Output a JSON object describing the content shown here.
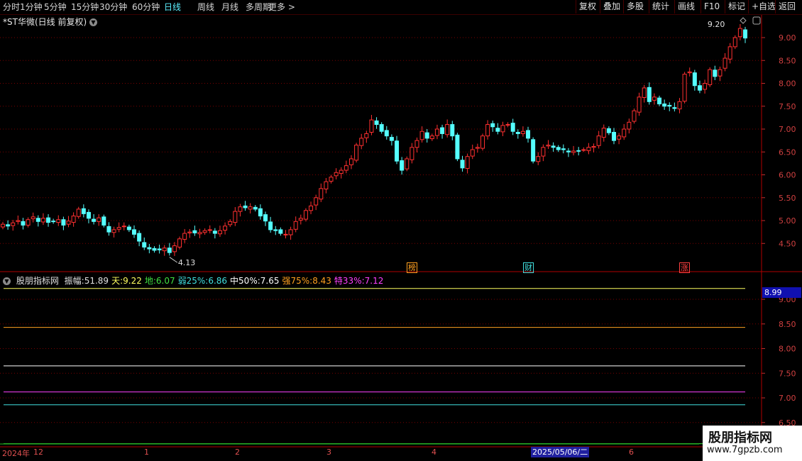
{
  "toolbar": {
    "periods": [
      "分时",
      "1分钟",
      "5分钟",
      "15分钟",
      "30分钟",
      "60分钟",
      "日线",
      "周线",
      "月线",
      "多周期",
      "更多 >"
    ],
    "active_period": "日线",
    "right_buttons": [
      "复权",
      "叠加",
      "多股",
      "统计",
      "画线",
      "F10",
      "+自选",
      "返回"
    ],
    "tag_label": "标记"
  },
  "stock": {
    "title": "*ST华微(日线 前复权)"
  },
  "indicator": {
    "name": "股朋指标网",
    "items": [
      {
        "label": "振幅:",
        "value": "51.89",
        "color": "#e0e0e0"
      },
      {
        "label": "天:",
        "value": "9.22",
        "color": "#ffff60"
      },
      {
        "label": "地:",
        "value": "6.07",
        "color": "#40e040"
      },
      {
        "label": "弱25%:",
        "value": "6.86",
        "color": "#40e0e0"
      },
      {
        "label": "中50%:",
        "value": "7.65",
        "color": "#ffffff"
      },
      {
        "label": "强75%:",
        "value": "8.43",
        "color": "#ffa020"
      },
      {
        "label": "特33%:",
        "value": "7.12",
        "color": "#ff40ff"
      }
    ],
    "last_price_box": "8.99"
  },
  "axes": {
    "price_ticks": [
      "9.00",
      "8.50",
      "8.00",
      "7.50",
      "7.00",
      "6.50",
      "6.00",
      "5.50",
      "5.00",
      "4.50"
    ],
    "indicator_ticks": [
      "9.00",
      "8.50",
      "8.00",
      "7.50",
      "7.00",
      "6.50"
    ],
    "date_labels": [
      "2024年",
      "12",
      "1",
      "2",
      "3",
      "4",
      "6"
    ],
    "highlight_date": "2025/05/06/二"
  },
  "annotations": {
    "high_label": "9.20",
    "low_label": "4.13",
    "event_tags": [
      {
        "text": "榜",
        "color": "#ffa020"
      },
      {
        "text": "财",
        "color": "#40e0e0"
      },
      {
        "text": "涨",
        "color": "#ff4040"
      }
    ]
  },
  "watermark": {
    "big": "股朋指标网",
    "small": "www.7gpzb.com"
  },
  "colors": {
    "up": "#ff3030",
    "down": "#55ffff",
    "grid": "#7a0000",
    "bg": "#000000"
  },
  "chart_data": {
    "type": "candlestick",
    "ylim": [
      4.13,
      9.2
    ],
    "indicator_lines": [
      {
        "name": "天",
        "value": 9.22,
        "color": "#ffff60"
      },
      {
        "name": "强75%",
        "value": 8.43,
        "color": "#ffa020"
      },
      {
        "name": "中50%",
        "value": 7.65,
        "color": "#ffffff"
      },
      {
        "name": "特33%",
        "value": 7.12,
        "color": "#ff40ff"
      },
      {
        "name": "弱25%",
        "value": 6.86,
        "color": "#40e0e0"
      },
      {
        "name": "地",
        "value": 6.07,
        "color": "#40e040"
      }
    ],
    "closes": [
      4.92,
      4.88,
      4.95,
      5.0,
      4.9,
      5.02,
      5.08,
      4.98,
      5.05,
      4.96,
      4.98,
      5.02,
      4.9,
      4.99,
      5.1,
      5.25,
      5.15,
      5.05,
      4.98,
      5.06,
      4.9,
      4.75,
      4.8,
      4.85,
      4.88,
      4.8,
      4.7,
      4.55,
      4.42,
      4.38,
      4.35,
      4.36,
      4.4,
      4.3,
      4.45,
      4.6,
      4.72,
      4.75,
      4.73,
      4.74,
      4.78,
      4.8,
      4.72,
      4.78,
      4.88,
      4.98,
      5.2,
      5.3,
      5.28,
      5.3,
      5.25,
      5.1,
      4.99,
      4.8,
      4.78,
      4.72,
      4.7,
      4.8,
      4.98,
      5.05,
      5.22,
      5.32,
      5.5,
      5.7,
      5.85,
      5.95,
      6.05,
      6.1,
      6.2,
      6.35,
      6.65,
      6.8,
      6.9,
      7.2,
      7.1,
      6.95,
      6.85,
      6.75,
      6.3,
      6.1,
      6.35,
      6.6,
      6.75,
      6.95,
      6.8,
      6.85,
      7.0,
      6.9,
      7.1,
      6.85,
      6.35,
      6.15,
      6.4,
      6.55,
      6.6,
      6.85,
      7.1,
      7.05,
      6.95,
      7.08,
      7.1,
      6.95,
      6.9,
      6.95,
      6.8,
      6.3,
      6.4,
      6.6,
      6.65,
      6.6,
      6.55,
      6.55,
      6.5,
      6.52,
      6.52,
      6.55,
      6.6,
      6.62,
      6.85,
      7.02,
      6.92,
      6.75,
      6.85,
      7.0,
      7.15,
      7.4,
      7.7,
      7.9,
      7.6,
      7.7,
      7.55,
      7.5,
      7.5,
      7.45,
      7.6,
      8.2,
      8.25,
      7.95,
      7.85,
      8.0,
      8.3,
      8.15,
      8.3,
      8.55,
      8.8,
      9.0,
      9.2,
      8.99
    ]
  }
}
